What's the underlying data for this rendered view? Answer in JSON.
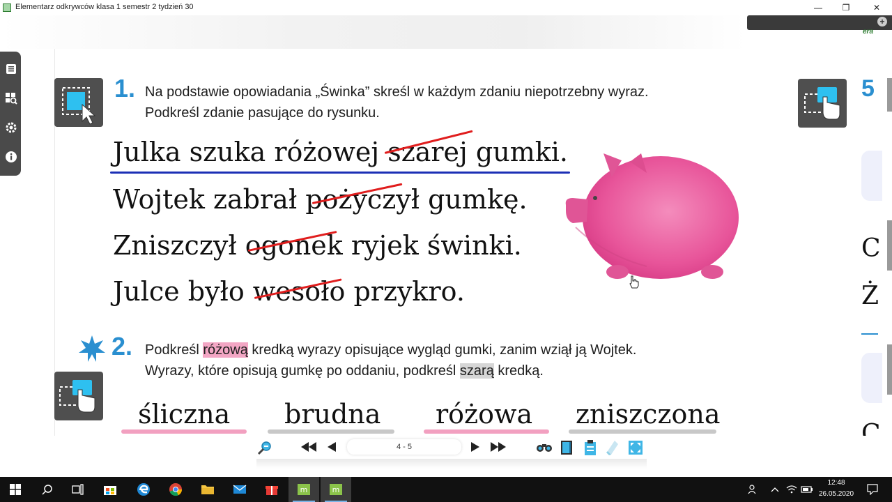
{
  "window": {
    "title": "Elementarz odkrywców klasa 1 semestr 2 tydzień 30",
    "minimize": "—",
    "restore": "❐",
    "close": "✕"
  },
  "logo": "era",
  "exercise1": {
    "number": "1.",
    "instruction_line1": "Na podstawie opowiadania „Świnka” skreśl w każdym zdaniu niepotrzebny wyraz.",
    "instruction_line2": "Podkreśl zdanie pasujące do rysunku.",
    "sentences": [
      {
        "before": "Julka szuka różowej ",
        "struck": "szarej",
        "after": " gumki."
      },
      {
        "before": "Wojtek zabrał ",
        "struck": "pożyczył",
        "after": " gumkę."
      },
      {
        "before": "Zniszczył ",
        "struck": "ogonek",
        "after": " ryjek świnki."
      },
      {
        "before": "Julce było ",
        "struck": "wesoło",
        "after": " przykro."
      }
    ]
  },
  "exercise2": {
    "number": "2.",
    "line1_a": "Podkreśl ",
    "line1_hl": "różową",
    "line1_b": " kredką wyrazy opisujące wygląd gumki, zanim wziął ją Wojtek.",
    "line2_a": "Wyrazy, które opisują gumkę po oddaniu, podkreśl ",
    "line2_hl": "szarą",
    "line2_b": " kredką.",
    "words": [
      {
        "text": "śliczna",
        "color": "#f2a0c0"
      },
      {
        "text": "brudna",
        "color": "#c8c8c8"
      },
      {
        "text": "różowa",
        "color": "#f2a0c0"
      },
      {
        "text": "zniszczona",
        "color": "#c8c8c8"
      }
    ]
  },
  "right_page": {
    "number": "5",
    "letter1": "C",
    "letter2": "Ż",
    "letter3": "C"
  },
  "navigation": {
    "page_indicator": "4 - 5"
  },
  "taskbar": {
    "time": "12:48",
    "date": "26.05.2020"
  },
  "colors": {
    "accent_blue": "#2a8fd0",
    "strike_red": "#e01d1d",
    "underline_blue": "#1c2fb5",
    "pig_pink": "#e8559a"
  }
}
